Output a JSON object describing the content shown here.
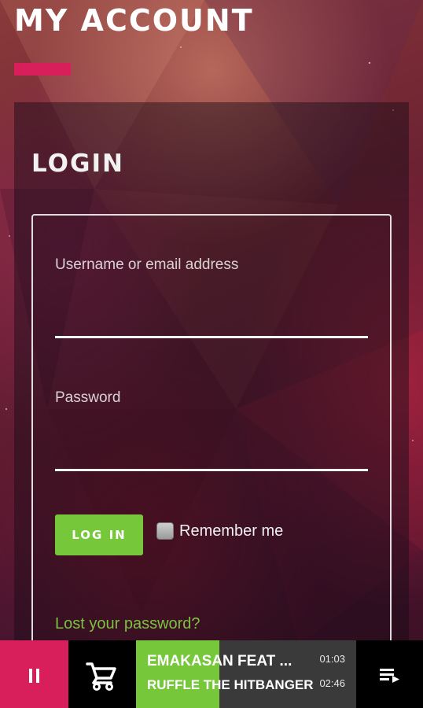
{
  "page": {
    "title": "MY ACCOUNT"
  },
  "login": {
    "heading": "LOGIN",
    "username_label": "Username or email address",
    "username_value": "",
    "password_label": "Password",
    "password_value": "",
    "submit_label": "LOG IN",
    "remember_label": "Remember me",
    "remember_checked": false,
    "lost_password_link": "Lost your password?"
  },
  "player": {
    "track_title": "EMAKASAN FEAT ...",
    "track_artist": "RUFFLE THE HITBANGER",
    "elapsed": "01:03",
    "duration": "02:46",
    "progress": 0.38,
    "pause_icon": "pause-icon",
    "cart_icon": "cart-icon",
    "queue_icon": "playlist-icon"
  },
  "colors": {
    "accent": "#d81e5b",
    "button_green": "#76c73a",
    "link_green": "#7bc23f"
  }
}
